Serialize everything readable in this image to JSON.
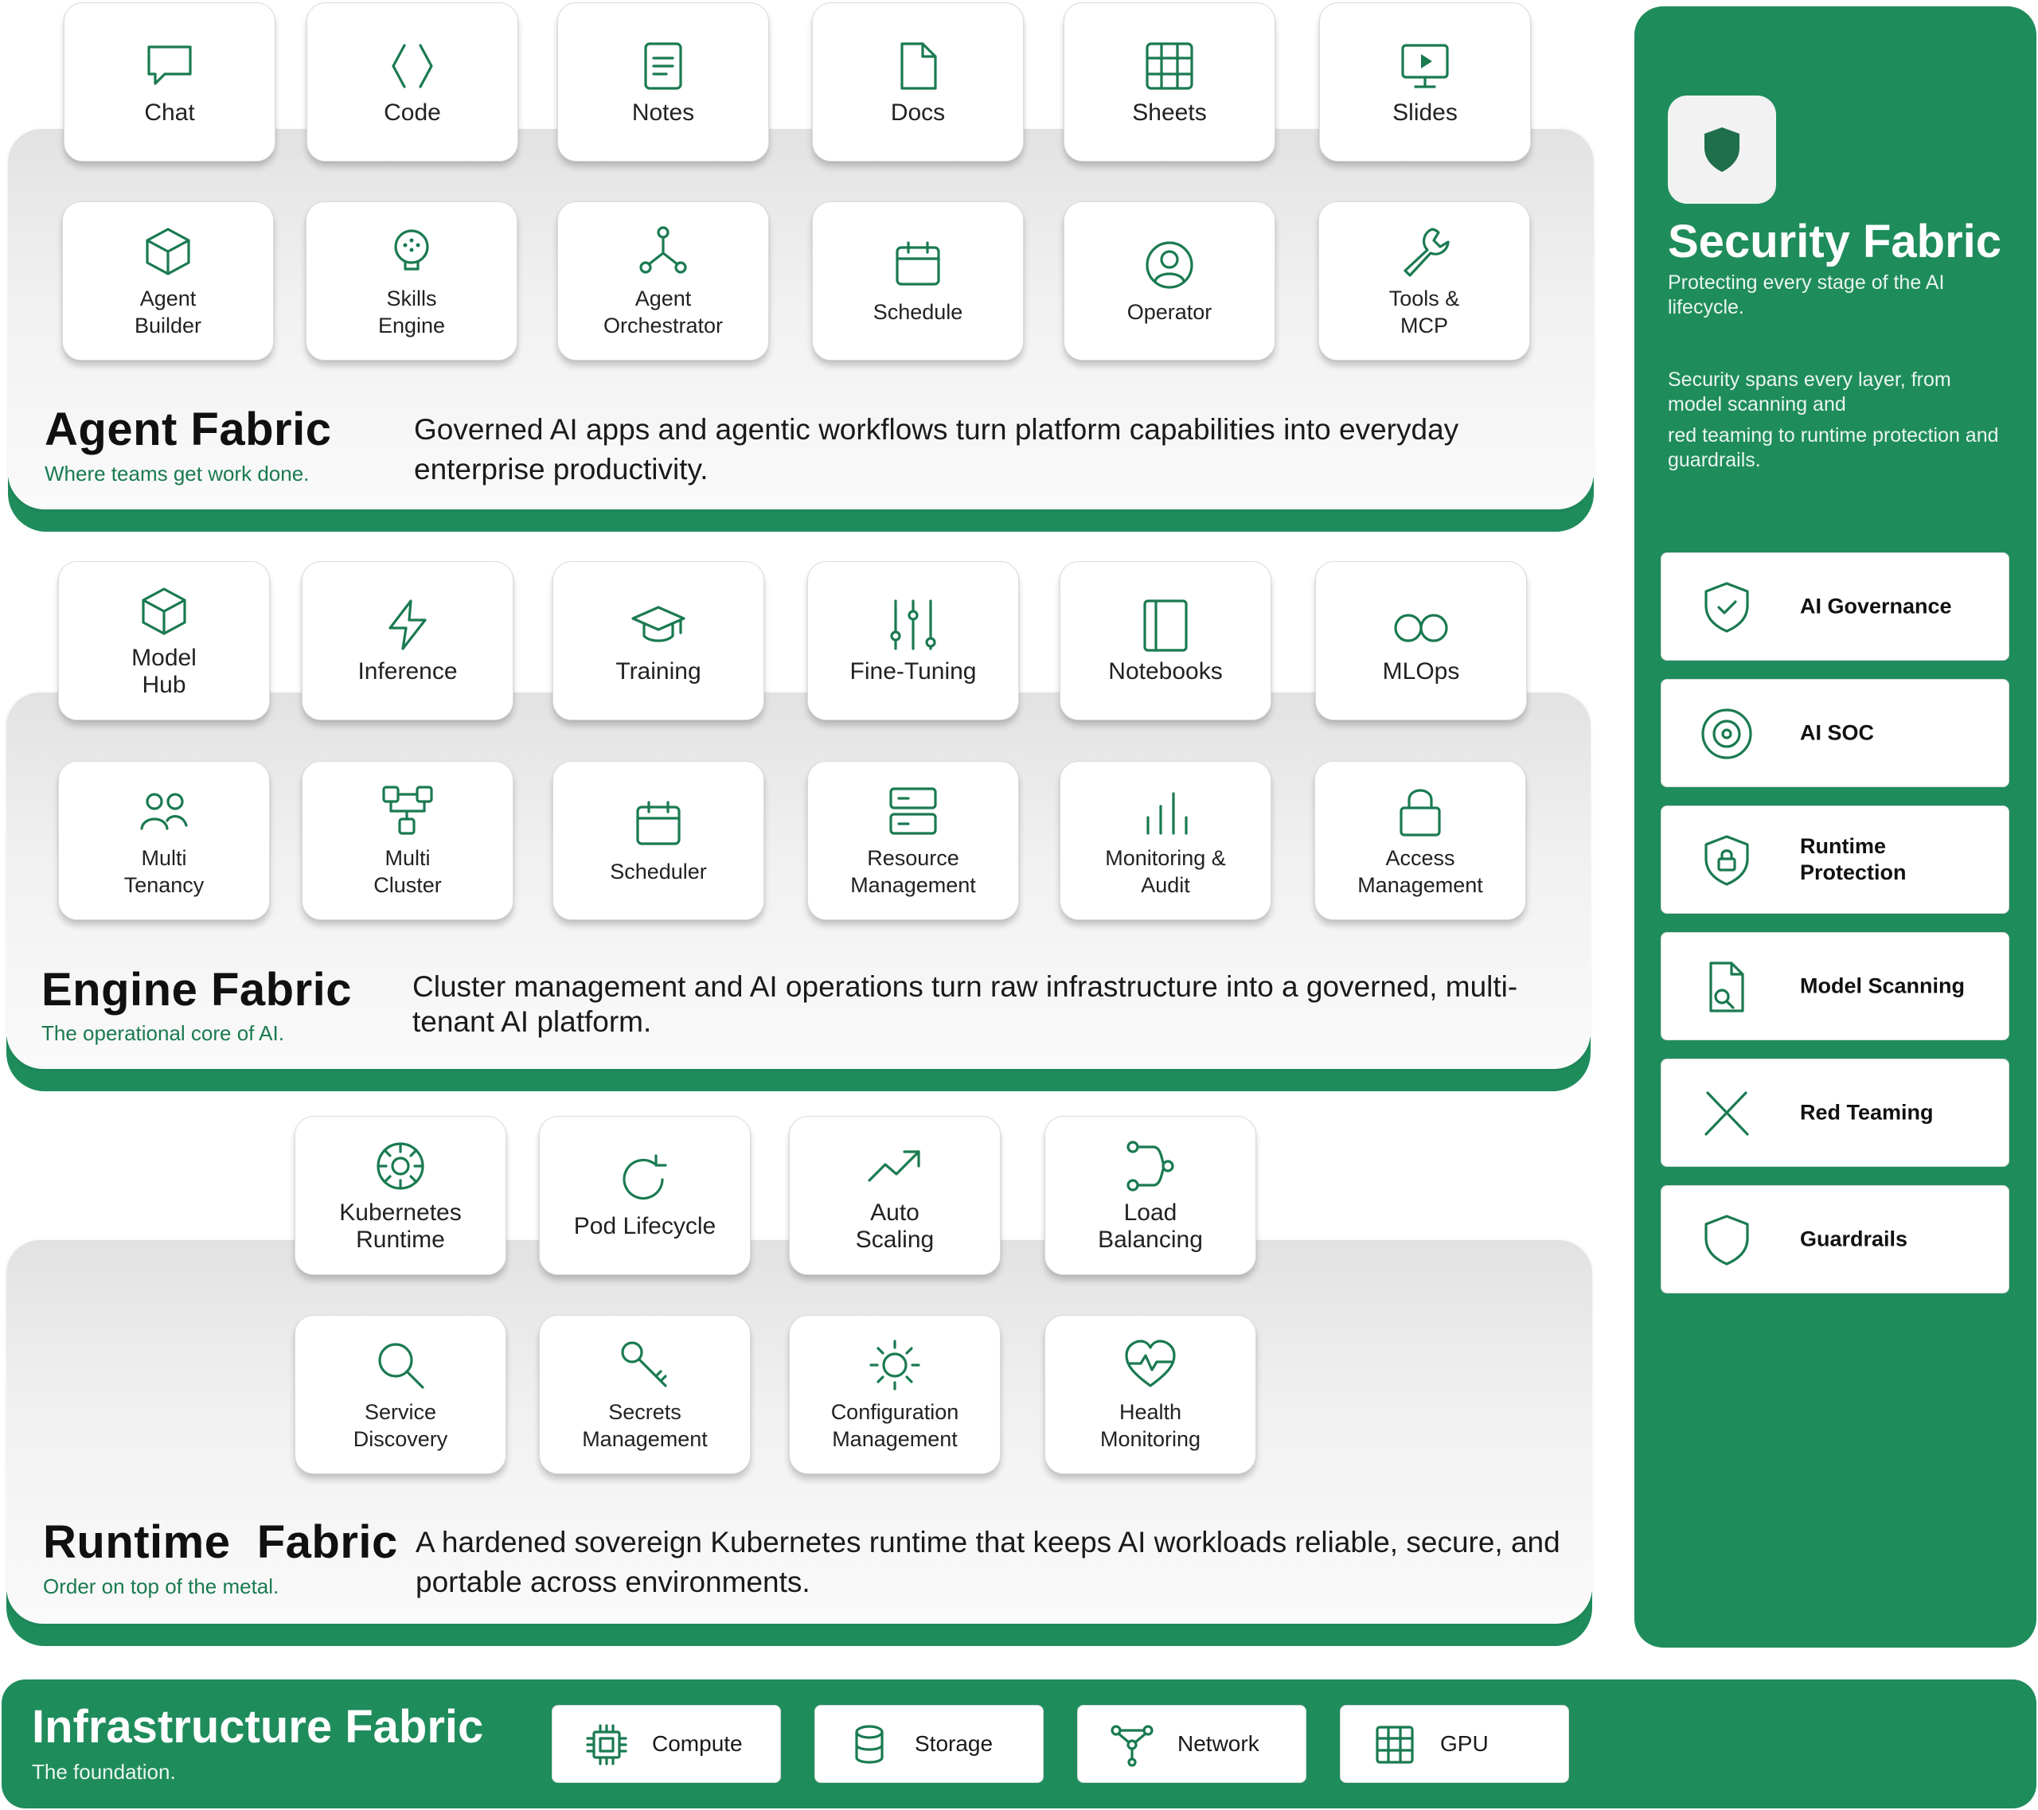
{
  "agent": {
    "title": "Agent Fabric",
    "subtitle": "Where teams get work done.",
    "description": "Governed AI apps and agentic workflows turn platform capabilities into everyday enterprise productivity.",
    "row1": [
      "Chat",
      "Code",
      "Notes",
      "Docs",
      "Sheets",
      "Slides"
    ],
    "row2": [
      "Agent\nBuilder",
      "Skills\nEngine",
      "Agent\nOrchestrator",
      "Schedule",
      "Operator",
      "Tools &\nMCP"
    ]
  },
  "engine": {
    "title": "Engine Fabric",
    "subtitle": "The operational core of AI.",
    "description": "Cluster management and AI operations turn raw infrastructure into a governed, multi-tenant AI platform.",
    "row1": [
      "Model\nHub",
      "Inference",
      "Training",
      "Fine-Tuning",
      "Notebooks",
      "MLOps"
    ],
    "row2": [
      "Multi\nTenancy",
      "Multi\nCluster",
      "Scheduler",
      "Resource\nManagement",
      "Monitoring &\nAudit",
      "Access\nManagement"
    ]
  },
  "runtime": {
    "title": "Runtime  Fabric",
    "subtitle": "Order on top of the metal.",
    "description": "A hardened sovereign Kubernetes runtime that keeps AI workloads reliable, secure, and portable across environments.",
    "row1": [
      "Kubernetes\nRuntime",
      "Pod Lifecycle",
      "Auto\nScaling",
      "Load\nBalancing"
    ],
    "row2": [
      "Service\nDiscovery",
      "Secrets\nManagement",
      "Configuration\nManagement",
      "Health\nMonitoring"
    ]
  },
  "security": {
    "title": "Security Fabric",
    "subtitle": "Protecting every stage of the AI lifecycle.",
    "desc1": "Security spans every layer, from model scanning and",
    "desc2": "red teaming to runtime protection and guardrails.",
    "items": [
      "AI Governance",
      "AI SOC",
      "Runtime\nProtection",
      "Model Scanning",
      "Red Teaming",
      "Guardrails"
    ]
  },
  "infrastructure": {
    "title": "Infrastructure Fabric",
    "subtitle": "The foundation.",
    "items": [
      "Compute",
      "Storage",
      "Network",
      "GPU"
    ]
  },
  "colors": {
    "brand_green": "#1f8c5c",
    "icon_green": "#1a7a50"
  }
}
